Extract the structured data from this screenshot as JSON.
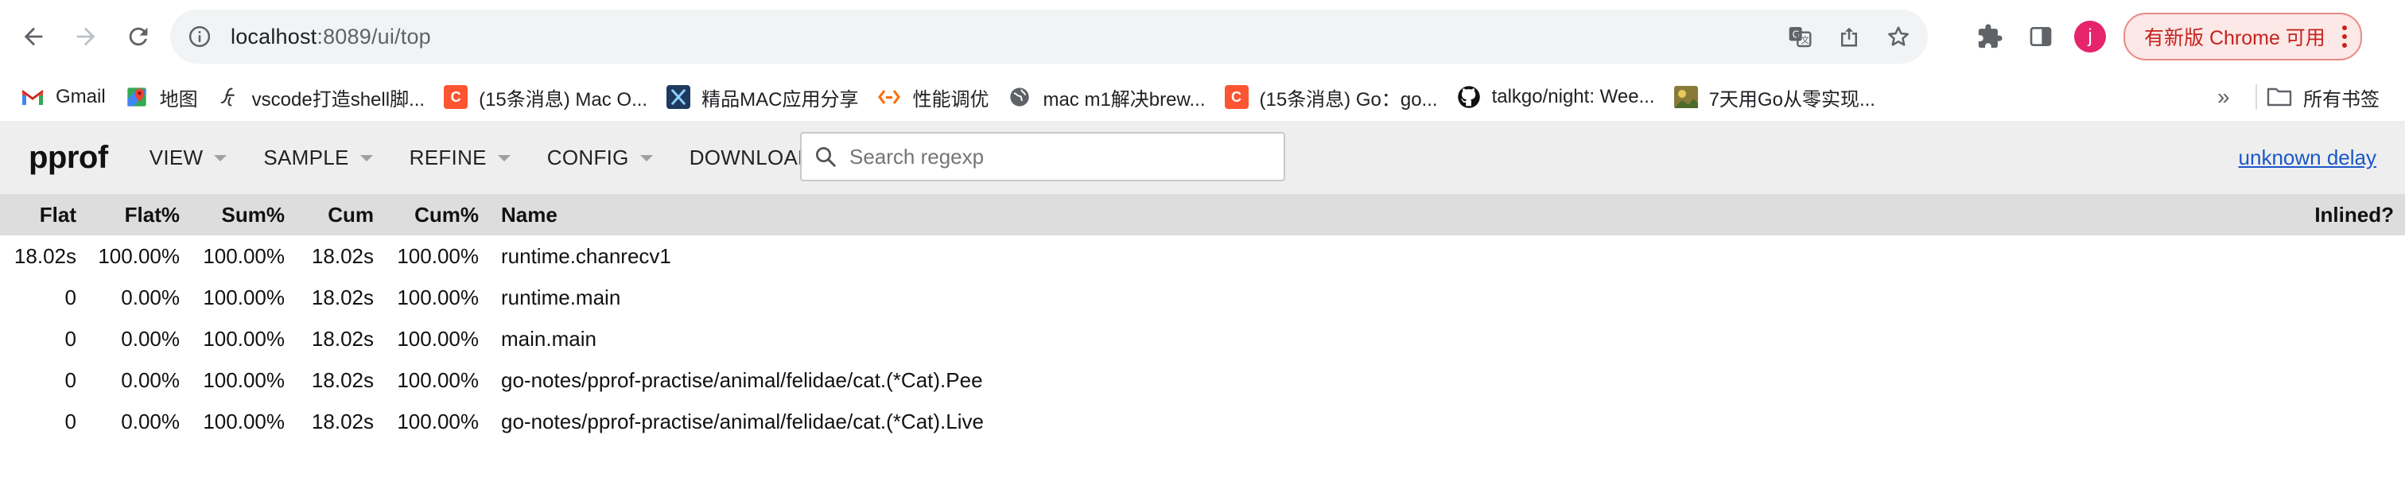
{
  "browser": {
    "url_host": "localhost",
    "url_rest": ":8089/ui/top",
    "avatar_letter": "j",
    "update_button_label": "有新版 Chrome 可用",
    "colors": {
      "update_bg": "#fce8e6",
      "update_text": "#c5221f",
      "avatar_bg": "#e5246b"
    }
  },
  "bookmarks": {
    "items": [
      {
        "icon": "gmail-icon",
        "label": "Gmail"
      },
      {
        "icon": "google-maps-icon",
        "label": "地图"
      },
      {
        "icon": "bookmark-script-icon",
        "label": "vscode打造shell脚..."
      },
      {
        "icon": "csdn-icon",
        "label": "(15条消息) Mac O..."
      },
      {
        "icon": "xcode-icon",
        "label": "精品MAC应用分享"
      },
      {
        "icon": "performance-icon",
        "label": "性能调优"
      },
      {
        "icon": "globe-icon",
        "label": "mac m1解决brew..."
      },
      {
        "icon": "csdn-icon",
        "label": "(15条消息) Go：go..."
      },
      {
        "icon": "github-icon",
        "label": "talkgo/night: Wee..."
      },
      {
        "icon": "image-thumb-icon",
        "label": "7天用Go从零实现..."
      }
    ],
    "overflow": "»",
    "all_bookmarks_label": "所有书签"
  },
  "pprof": {
    "logo": "pprof",
    "menu": [
      {
        "label": "VIEW",
        "dropdown": true
      },
      {
        "label": "SAMPLE",
        "dropdown": true
      },
      {
        "label": "REFINE",
        "dropdown": true
      },
      {
        "label": "CONFIG",
        "dropdown": true
      },
      {
        "label": "DOWNLOAD",
        "dropdown": false
      }
    ],
    "search": {
      "placeholder": "Search regexp",
      "value": ""
    },
    "right_link": "unknown delay"
  },
  "table": {
    "headers": [
      "Flat",
      "Flat%",
      "Sum%",
      "Cum",
      "Cum%",
      "Name",
      "Inlined?"
    ],
    "rows": [
      [
        "18.02s",
        "100.00%",
        "100.00%",
        "18.02s",
        "100.00%",
        "runtime.chanrecv1",
        ""
      ],
      [
        "0",
        "0.00%",
        "100.00%",
        "18.02s",
        "100.00%",
        "runtime.main",
        ""
      ],
      [
        "0",
        "0.00%",
        "100.00%",
        "18.02s",
        "100.00%",
        "main.main",
        ""
      ],
      [
        "0",
        "0.00%",
        "100.00%",
        "18.02s",
        "100.00%",
        "go-notes/pprof-practise/animal/felidae/cat.(*Cat).Pee",
        ""
      ],
      [
        "0",
        "0.00%",
        "100.00%",
        "18.02s",
        "100.00%",
        "go-notes/pprof-practise/animal/felidae/cat.(*Cat).Live",
        ""
      ]
    ]
  }
}
